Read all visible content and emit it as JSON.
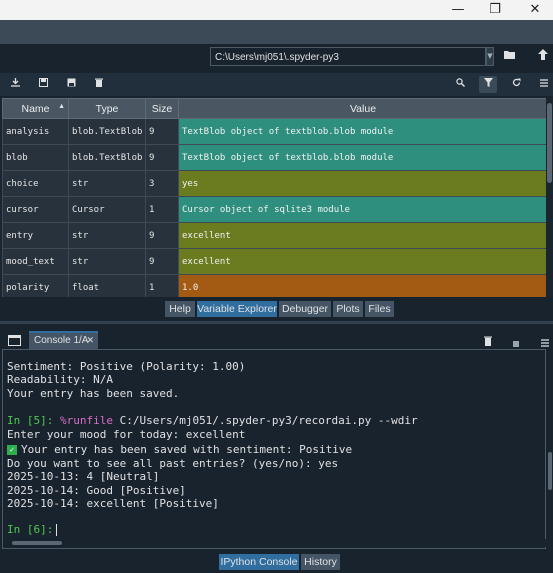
{
  "window": {
    "minimize": "—",
    "maximize": "❐",
    "close": "✕"
  },
  "path_bar": {
    "value": "C:\\Users\\mj051\\.spyder-py3"
  },
  "variables": {
    "headers": {
      "name": "Name",
      "type": "Type",
      "size": "Size",
      "value": "Value"
    },
    "rows": [
      {
        "name": "analysis",
        "type": "blob.TextBlob",
        "size": "9",
        "value": "TextBlob object of textblob.blob module",
        "color": "#2e8f7e"
      },
      {
        "name": "blob",
        "type": "blob.TextBlob",
        "size": "9",
        "value": "TextBlob object of textblob.blob module",
        "color": "#2e8f7e"
      },
      {
        "name": "choice",
        "type": "str",
        "size": "3",
        "value": "yes",
        "color": "#6b7b1f"
      },
      {
        "name": "cursor",
        "type": "Cursor",
        "size": "1",
        "value": "Cursor object of sqlite3 module",
        "color": "#2e8f7e"
      },
      {
        "name": "entry",
        "type": "str",
        "size": "9",
        "value": "excellent",
        "color": "#6b7b1f"
      },
      {
        "name": "mood_text",
        "type": "str",
        "size": "9",
        "value": "excellent",
        "color": "#6b7b1f"
      },
      {
        "name": "polarity",
        "type": "float",
        "size": "1",
        "value": "1.0",
        "color": "#a35a13"
      }
    ]
  },
  "pane_tabs": [
    "Help",
    "Variable Explorer",
    "Debugger",
    "Plots",
    "Files"
  ],
  "pane_tabs_selected": "Variable Explorer",
  "console": {
    "tab_label": "Console 1/A",
    "lines": {
      "l1": "Sentiment: Positive (Polarity: 1.00)",
      "l2": "Readability: N/A",
      "l3": "Your entry has been saved.",
      "prompt5": "In [5]:",
      "magic": "%runfile",
      "command": "C:/Users/mj051/.spyder-py3/recordai.py --wdir",
      "l5": "Enter your mood for today: excellent",
      "l6": "Your entry has been saved with sentiment: Positive",
      "l7": "Do you want to see all past entries? (yes/no): yes",
      "l8": "2025-10-13: 4 [Neutral]",
      "l9": "2025-10-14: Good [Positive]",
      "l10": "2025-10-14: excellent [Positive]",
      "prompt6": "In [6]:"
    }
  },
  "bottom_tabs": [
    "IPython Console",
    "History"
  ],
  "bottom_tabs_selected": "IPython Console"
}
